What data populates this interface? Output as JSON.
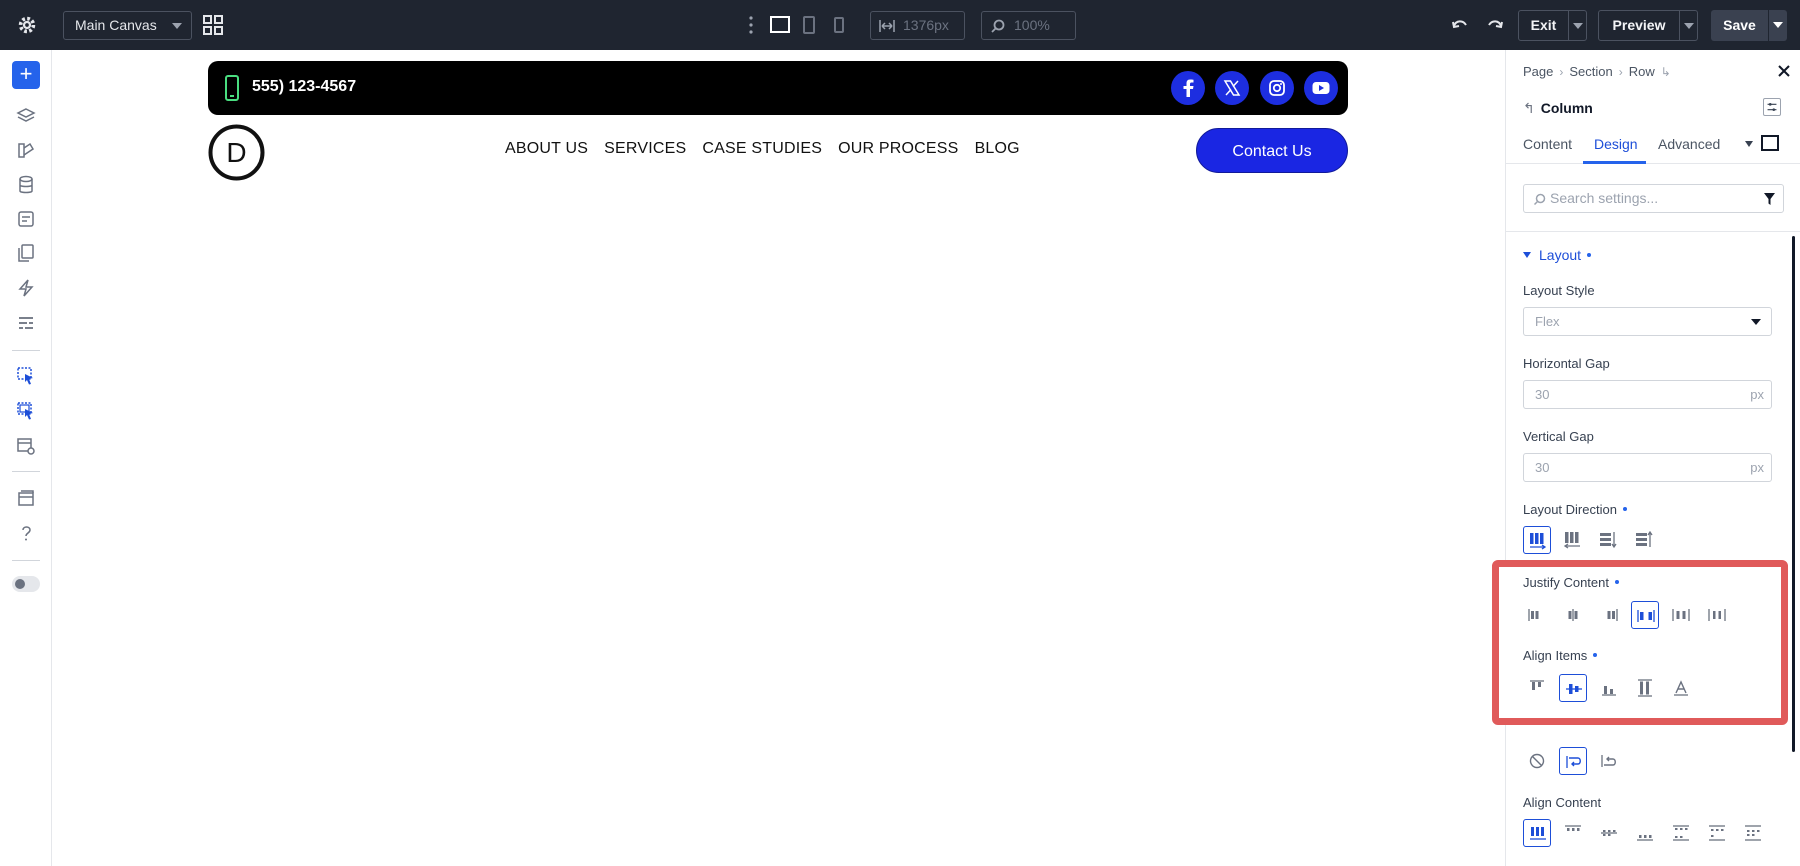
{
  "topbar": {
    "canvas_label": "Main Canvas",
    "width_value": "1376px",
    "zoom_value": "100%",
    "exit_label": "Exit",
    "preview_label": "Preview",
    "save_label": "Save"
  },
  "canvas": {
    "phone": "555) 123-4567",
    "logo_letter": "D",
    "nav": [
      "ABOUT US",
      "SERVICES",
      "CASE STUDIES",
      "OUR PROCESS",
      "BLOG"
    ],
    "cta": "Contact Us",
    "social": [
      "facebook-icon",
      "x-icon",
      "instagram-icon",
      "youtube-icon"
    ],
    "social_color": "#1d2ee0"
  },
  "panel": {
    "breadcrumb": [
      "Page",
      "Section",
      "Row"
    ],
    "element_title": "Column",
    "tabs": [
      "Content",
      "Design",
      "Advanced"
    ],
    "active_tab": "Design",
    "search_placeholder": "Search settings...",
    "section_title": "Layout",
    "layout_style_label": "Layout Style",
    "layout_style_value": "Flex",
    "horizontal_gap_label": "Horizontal Gap",
    "horizontal_gap_value": "30",
    "horizontal_gap_unit": "px",
    "vertical_gap_label": "Vertical Gap",
    "vertical_gap_value": "30",
    "vertical_gap_unit": "px",
    "layout_direction_label": "Layout Direction",
    "justify_content_label": "Justify Content",
    "align_items_label": "Align Items",
    "align_content_label": "Align Content",
    "accent_color": "#1d4ed8",
    "highlight_color": "#e05a5a"
  }
}
